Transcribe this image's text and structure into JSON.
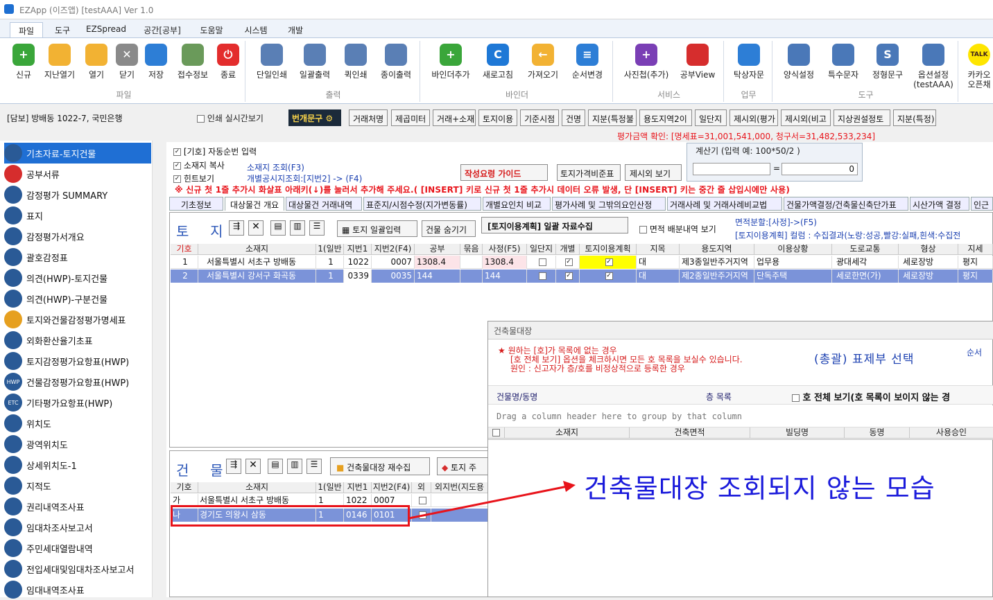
{
  "window": {
    "title": "EZApp (이즈앱) [testAAA] Ver 1.0"
  },
  "menu_tabs": [
    "파일",
    "도구",
    "EZSpread",
    "공간[공부]",
    "도움말",
    "시스템",
    "개발"
  ],
  "ribbon": {
    "groups": [
      "파일",
      "출력",
      "바인더",
      "서비스",
      "업무",
      "도구"
    ],
    "buttons": [
      "신규",
      "지난열기",
      "열기",
      "닫기",
      "저장",
      "접수정보",
      "종료",
      "단일인쇄",
      "일괄출력",
      "퀵인쇄",
      "종이출력",
      "바인더추가",
      "새로고침",
      "가져오기",
      "순서변경",
      "사진첩(추가)",
      "공부View",
      "탁상자문",
      "양식설정",
      "특수문자",
      "정형문구",
      "옵션설정\n(testAAA)",
      "카카오\n오픈채"
    ],
    "talk_label": "TALK"
  },
  "toolbar2": {
    "case_label": "[담보] 방배동 1022-7, 국민은행",
    "print_preview_label": "인쇄 실시간보기",
    "hotbutton": "번개문구 ⚙",
    "buttons": [
      "거래처명",
      "제곱미터",
      "거래+소재",
      "토지이용",
      "기준시점",
      "건명",
      "지분(특정불",
      "용도지역2이",
      "일단지",
      "제시외(평가",
      "제시외(비고",
      "지상권설정토",
      "지분(특정)"
    ]
  },
  "valuation_check": "평가금액 확인: [명세표=31,001,541,000, 청구서=31,482,533,234]",
  "sidebar": {
    "items": [
      "기초자료-토지건물",
      "공부서류",
      "감정평가 SUMMARY",
      "표지",
      "감정평가서개요",
      "괄호감정표",
      "의견(HWP)-토지건물",
      "의견(HWP)-구분건물",
      "토지와건물감정평가명세표",
      "외화환산율기초표",
      "토지감정평가요항표(HWP)",
      "건물감정평가요항표(HWP)",
      "기타평가요항표(HWP)",
      "위치도",
      "광역위치도",
      "상세위치도-1",
      "지적도",
      "권리내역조사표",
      "임대차조사보고서",
      "주민세대열람내역",
      "전입세대및임대차조사보고서",
      "임대내역조사표"
    ],
    "icon_badges": {
      "hwp": "HWP",
      "etc": "ETC"
    }
  },
  "options": {
    "auto_number": "[기호] 자동순번 입력",
    "copy_address": "소재지 복사",
    "hint": "힌트보기",
    "address_lookup": "소재지 조회(F3)",
    "land_price_lookup": "개별공시지조회:[지번2] -> (F4)",
    "guide_button": "작성요령 가이드",
    "land_price_standard": "토지가격비준표",
    "outside_view": "제시외 보기",
    "insert_notice": "※ 신규 첫 1줄 추가시 화살표 아래키(↓)를 눌러서 추가해 주세요.( [INSERT] 키로 신규 첫 1줄 추가시 데이터 오류 발생, 단 [INSERT] 키는 중간 줄 삽입시에만 사용)"
  },
  "calculator": {
    "label": "계산기  (입력 예: 100*50/2 )",
    "equals": "=",
    "result": "0"
  },
  "subtabs": [
    "기초정보",
    "대상물건 개요",
    "대상물건 거래내역",
    "표준지/시점수정(지가변동률)",
    "개별요인치 비교",
    "평가사례 및 그밖의요인산정",
    "거래사례 및 거래사례비교법",
    "건물가액결정/건축물신축단가표",
    "시산가액 결정",
    "인근"
  ],
  "land": {
    "title": "토  지",
    "batch_button": "토지 일괄입력",
    "hide_building": "건물 숨기기",
    "land_use_batch": "[토지이용계획] 일괄 자료수집",
    "area_alloc": "면적 배분내역 보기",
    "area_split": "면적분할:[사정]->(F5)",
    "land_use_result": "[토지이용계획] 컬럼 :  수집결과(노랑:성공,빨강:실패,흰색:수집전",
    "columns": [
      "기호",
      "소재지",
      "1(일반",
      "지번1",
      "지번2(F4)",
      "공부",
      "묶음",
      "사정(F5)",
      "일단지",
      "개별",
      "토지이용계획",
      "지목",
      "용도지역",
      "이용상황",
      "도로교통",
      "형상",
      "지세"
    ],
    "rows": [
      [
        "1",
        "서울특별시 서초구 방배동",
        "1",
        "1022",
        "0007",
        "1308.4",
        "",
        "1308.4",
        "",
        "✓",
        "✓",
        "대",
        "제3종일반주거지역",
        "업무용",
        "광대세각",
        "세로장방",
        "평지"
      ],
      [
        "2",
        "서울특별시 강서구 화곡동",
        "1",
        "0339",
        "0035",
        "144",
        "",
        "144",
        "",
        "✓",
        "✓",
        "대",
        "제2종일반주거지역",
        "단독주택",
        "세로한면(가)",
        "세로장방",
        "평지"
      ]
    ]
  },
  "building": {
    "title": "건  물",
    "recollect": "건축물대장 재수집",
    "land_partial": "토지 주",
    "columns": [
      "기호",
      "소재지",
      "1(일반",
      "지번1",
      "지번2(F4)",
      "외",
      "외지번(지도용"
    ],
    "rows": [
      [
        "가",
        "서울특별시 서초구 방배동",
        "1",
        "1022",
        "0007",
        ""
      ],
      [
        "나",
        "경기도 의왕시 삼동",
        "1",
        "0146",
        "0101",
        ""
      ]
    ]
  },
  "register_panel": {
    "title": "건축물대장",
    "note1": "★ 원하는 [호]가 목록에 없는 경우",
    "note2": "[호 전체 보기] 옵션을 체크하시면 모든 호 목록을 보실수 있습니다.",
    "note3": "원인 : 신고자가 층/호를 비정상적으로 등록한 경우",
    "select_label": "(총괄) 표제부 선택",
    "order_label": "순서",
    "building_name": "건물명/동명",
    "floor_list": "층 목록",
    "show_all": "호 전체 보기(호 목록이 보이지 않는 경",
    "group_hint": "Drag a column header here to group by that column",
    "columns": [
      "소재지",
      "건축면적",
      "빌딩명",
      "동명",
      "사용승인"
    ]
  },
  "annotation": "건축물대장 조회되지 않는 모습",
  "colors": {
    "accent": "#1f6fd4",
    "annotation": "#1a1adb",
    "highlight_red": "#e8131a",
    "yellow": "#ffff00"
  }
}
